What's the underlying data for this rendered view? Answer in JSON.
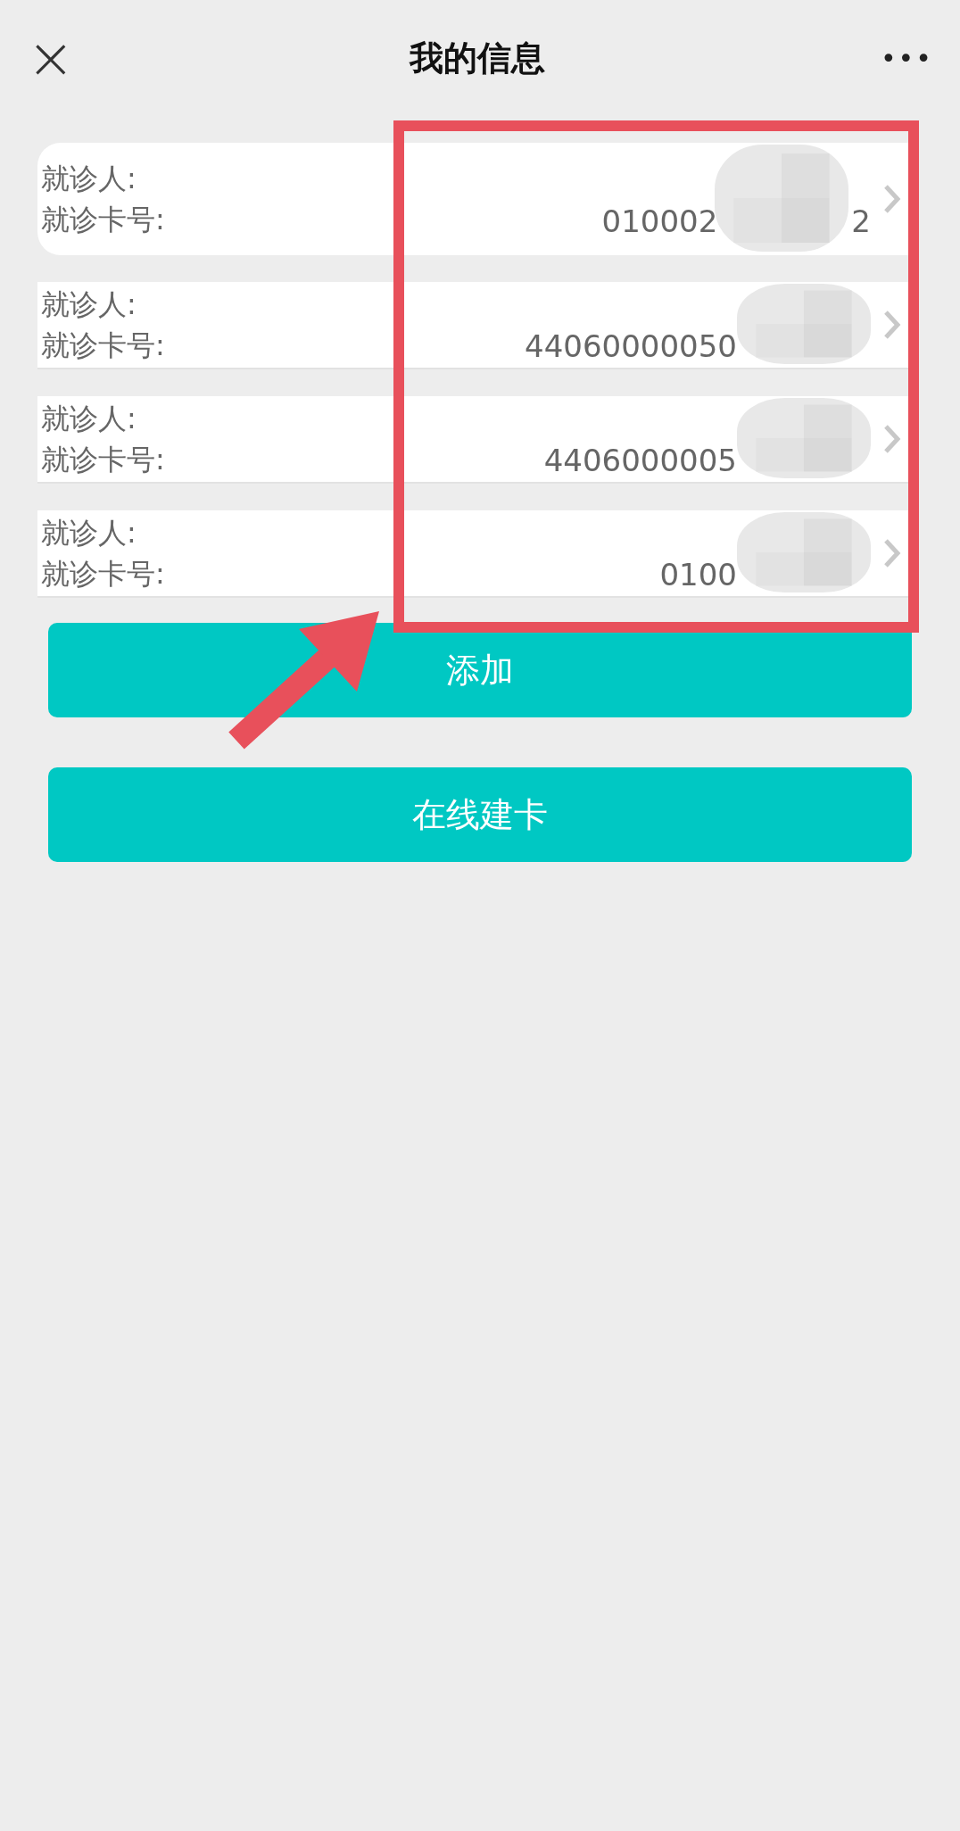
{
  "header": {
    "close": "×",
    "title": "我的信息",
    "more": "•••"
  },
  "patients": [
    {
      "name_label": "就诊人:",
      "card_label": "就诊卡号:",
      "card_number_visible": "010002",
      "card_number_tail": "2"
    },
    {
      "name_label": "就诊人:",
      "card_label": "就诊卡号:",
      "card_number_visible": "44060000050"
    },
    {
      "name_label": "就诊人:",
      "card_label": "就诊卡号:",
      "card_number_visible": "4406000005"
    },
    {
      "name_label": "就诊人:",
      "card_label": "就诊卡号:",
      "card_number_visible": "0100"
    }
  ],
  "buttons": [
    "添加",
    "在线建卡"
  ]
}
